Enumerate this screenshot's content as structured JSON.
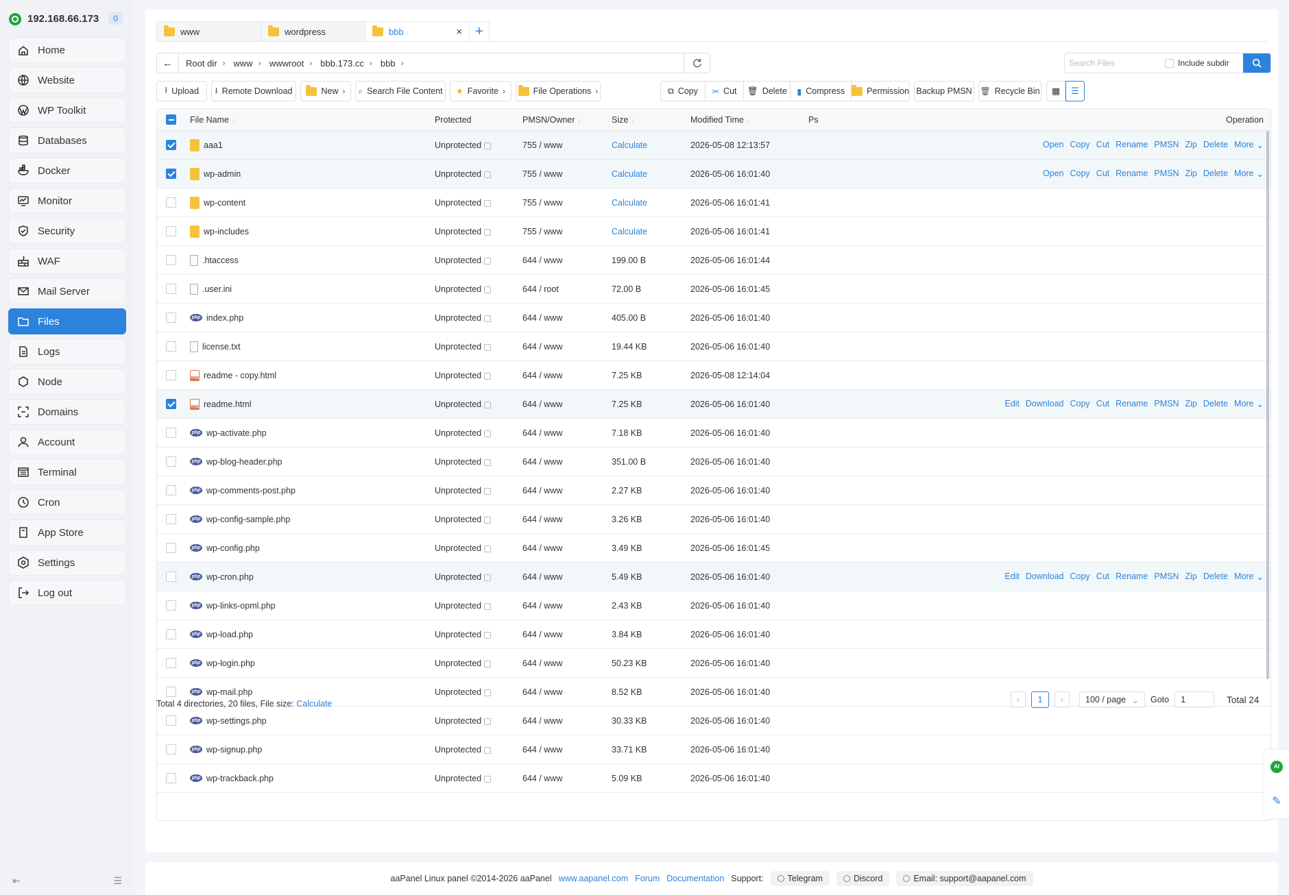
{
  "sidebar": {
    "ip": "192.168.66.173",
    "badge": "0",
    "items": [
      {
        "label": "Home",
        "icon": "home-icon"
      },
      {
        "label": "Website",
        "icon": "globe-icon"
      },
      {
        "label": "WP Toolkit",
        "icon": "wordpress-icon"
      },
      {
        "label": "Databases",
        "icon": "database-icon"
      },
      {
        "label": "Docker",
        "icon": "docker-icon"
      },
      {
        "label": "Monitor",
        "icon": "monitor-icon"
      },
      {
        "label": "Security",
        "icon": "shield-icon"
      },
      {
        "label": "WAF",
        "icon": "firewall-icon"
      },
      {
        "label": "Mail Server",
        "icon": "mail-icon"
      },
      {
        "label": "Files",
        "icon": "folder-icon",
        "active": true
      },
      {
        "label": "Logs",
        "icon": "log-icon"
      },
      {
        "label": "Node",
        "icon": "node-icon"
      },
      {
        "label": "Domains",
        "icon": "domain-icon"
      },
      {
        "label": "Account",
        "icon": "user-icon"
      },
      {
        "label": "Terminal",
        "icon": "terminal-icon"
      },
      {
        "label": "Cron",
        "icon": "clock-icon"
      },
      {
        "label": "App Store",
        "icon": "store-icon"
      },
      {
        "label": "Settings",
        "icon": "settings-icon"
      },
      {
        "label": "Log out",
        "icon": "logout-icon"
      }
    ]
  },
  "tabs": [
    {
      "label": "www"
    },
    {
      "label": "wordpress"
    },
    {
      "label": "bbb",
      "active": true
    }
  ],
  "path": {
    "crumbs": [
      "Root dir",
      "www",
      "wwwroot",
      "bbb.173.cc",
      "bbb"
    ]
  },
  "search": {
    "placeholder": "Search Files",
    "include_subdir": "Include subdir"
  },
  "toolbar": {
    "upload": "Upload",
    "remote_download": "Remote Download",
    "new": "New",
    "search_content": "Search File Content",
    "favorite": "Favorite",
    "file_operations": "File Operations",
    "copy": "Copy",
    "cut": "Cut",
    "delete": "Delete",
    "compress": "Compress",
    "permission": "Permission",
    "backup_pmsn": "Backup PMSN",
    "recycle_bin": "Recycle Bin"
  },
  "table": {
    "headers": {
      "name": "File Name",
      "protected": "Protected",
      "pmsn": "PMSN/Owner",
      "size": "Size",
      "modified": "Modified Time",
      "ps": "Ps",
      "operation": "Operation"
    },
    "rows": [
      {
        "name": "aaa1",
        "type": "folder",
        "prot": "Unprotected",
        "perm": "755 / www",
        "size": "Calculate",
        "time": "2026-05-08 12:13:57",
        "checked": true,
        "ops": [
          "Open",
          "Copy",
          "Cut",
          "Rename",
          "PMSN",
          "Zip",
          "Delete",
          "More"
        ]
      },
      {
        "name": "wp-admin",
        "type": "folder",
        "prot": "Unprotected",
        "perm": "755 / www",
        "size": "Calculate",
        "time": "2026-05-06 16:01:40",
        "checked": true,
        "ops": [
          "Open",
          "Copy",
          "Cut",
          "Rename",
          "PMSN",
          "Zip",
          "Delete",
          "More"
        ]
      },
      {
        "name": "wp-content",
        "type": "folder",
        "prot": "Unprotected",
        "perm": "755 / www",
        "size": "Calculate",
        "time": "2026-05-06 16:01:41",
        "checked": false,
        "ops": []
      },
      {
        "name": "wp-includes",
        "type": "folder",
        "prot": "Unprotected",
        "perm": "755 / www",
        "size": "Calculate",
        "time": "2026-05-06 16:01:41",
        "checked": false,
        "ops": []
      },
      {
        "name": ".htaccess",
        "type": "file",
        "prot": "Unprotected",
        "perm": "644 / www",
        "size": "199.00 B",
        "time": "2026-05-06 16:01:44",
        "checked": false,
        "ops": []
      },
      {
        "name": ".user.ini",
        "type": "file",
        "prot": "Unprotected",
        "perm": "644 / root",
        "size": "72.00 B",
        "time": "2026-05-06 16:01:45",
        "checked": false,
        "ops": []
      },
      {
        "name": "index.php",
        "type": "php",
        "prot": "Unprotected",
        "perm": "644 / www",
        "size": "405.00 B",
        "time": "2026-05-06 16:01:40",
        "checked": false,
        "ops": []
      },
      {
        "name": "license.txt",
        "type": "file",
        "prot": "Unprotected",
        "perm": "644 / www",
        "size": "19.44 KB",
        "time": "2026-05-06 16:01:40",
        "checked": false,
        "ops": []
      },
      {
        "name": "readme - copy.html",
        "type": "html",
        "prot": "Unprotected",
        "perm": "644 / www",
        "size": "7.25 KB",
        "time": "2026-05-08 12:14:04",
        "checked": false,
        "ops": []
      },
      {
        "name": "readme.html",
        "type": "html",
        "prot": "Unprotected",
        "perm": "644 / www",
        "size": "7.25 KB",
        "time": "2026-05-06 16:01:40",
        "checked": true,
        "ops": [
          "Edit",
          "Download",
          "Copy",
          "Cut",
          "Rename",
          "PMSN",
          "Zip",
          "Delete",
          "More"
        ]
      },
      {
        "name": "wp-activate.php",
        "type": "php",
        "prot": "Unprotected",
        "perm": "644 / www",
        "size": "7.18 KB",
        "time": "2026-05-06 16:01:40",
        "checked": false,
        "ops": []
      },
      {
        "name": "wp-blog-header.php",
        "type": "php",
        "prot": "Unprotected",
        "perm": "644 / www",
        "size": "351.00 B",
        "time": "2026-05-06 16:01:40",
        "checked": false,
        "ops": []
      },
      {
        "name": "wp-comments-post.php",
        "type": "php",
        "prot": "Unprotected",
        "perm": "644 / www",
        "size": "2.27 KB",
        "time": "2026-05-06 16:01:40",
        "checked": false,
        "ops": []
      },
      {
        "name": "wp-config-sample.php",
        "type": "php",
        "prot": "Unprotected",
        "perm": "644 / www",
        "size": "3.26 KB",
        "time": "2026-05-06 16:01:40",
        "checked": false,
        "ops": []
      },
      {
        "name": "wp-config.php",
        "type": "php",
        "prot": "Unprotected",
        "perm": "644 / www",
        "size": "3.49 KB",
        "time": "2026-05-06 16:01:45",
        "checked": false,
        "ops": []
      },
      {
        "name": "wp-cron.php",
        "type": "php",
        "prot": "Unprotected",
        "perm": "644 / www",
        "size": "5.49 KB",
        "time": "2026-05-06 16:01:40",
        "checked": false,
        "hover": true,
        "ops": [
          "Edit",
          "Download",
          "Copy",
          "Cut",
          "Rename",
          "PMSN",
          "Zip",
          "Delete",
          "More"
        ]
      },
      {
        "name": "wp-links-opml.php",
        "type": "php",
        "prot": "Unprotected",
        "perm": "644 / www",
        "size": "2.43 KB",
        "time": "2026-05-06 16:01:40",
        "checked": false,
        "ops": []
      },
      {
        "name": "wp-load.php",
        "type": "php",
        "prot": "Unprotected",
        "perm": "644 / www",
        "size": "3.84 KB",
        "time": "2026-05-06 16:01:40",
        "checked": false,
        "ops": []
      },
      {
        "name": "wp-login.php",
        "type": "php",
        "prot": "Unprotected",
        "perm": "644 / www",
        "size": "50.23 KB",
        "time": "2026-05-06 16:01:40",
        "checked": false,
        "ops": []
      },
      {
        "name": "wp-mail.php",
        "type": "php",
        "prot": "Unprotected",
        "perm": "644 / www",
        "size": "8.52 KB",
        "time": "2026-05-06 16:01:40",
        "checked": false,
        "ops": []
      },
      {
        "name": "wp-settings.php",
        "type": "php",
        "prot": "Unprotected",
        "perm": "644 / www",
        "size": "30.33 KB",
        "time": "2026-05-06 16:01:40",
        "checked": false,
        "ops": []
      },
      {
        "name": "wp-signup.php",
        "type": "php",
        "prot": "Unprotected",
        "perm": "644 / www",
        "size": "33.71 KB",
        "time": "2026-05-06 16:01:40",
        "checked": false,
        "ops": []
      },
      {
        "name": "wp-trackback.php",
        "type": "php",
        "prot": "Unprotected",
        "perm": "644 / www",
        "size": "5.09 KB",
        "time": "2026-05-06 16:01:40",
        "checked": false,
        "ops": []
      }
    ]
  },
  "footer_info": {
    "summary": "Total 4 directories, 20 files, File size:",
    "calculate": "Calculate"
  },
  "pager": {
    "page": "1",
    "page_size": "100 / page",
    "goto_label": "Goto",
    "goto_value": "1",
    "total": "Total 24"
  },
  "page_footer": {
    "copyright": "aaPanel Linux panel ©2014-2026 aaPanel",
    "site": "www.aapanel.com",
    "forum": "Forum",
    "docs": "Documentation",
    "support": "Support:",
    "telegram": "Telegram",
    "discord": "Discord",
    "email": "Email: support@aapanel.com"
  },
  "float": {
    "ai": "AI"
  },
  "colors": {
    "accent": "#2d82dc",
    "brand_green": "#20a53a"
  }
}
